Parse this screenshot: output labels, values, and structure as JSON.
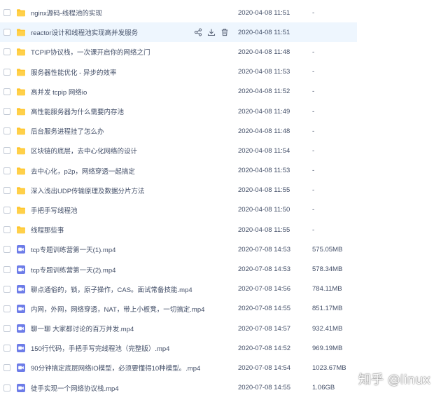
{
  "files": [
    {
      "name": "nginx源码-线程池的实现",
      "date": "2020-04-08 11:51",
      "size": "-",
      "type": "folder"
    },
    {
      "name": "reactor设计和线程池实现高并发服务",
      "date": "2020-04-08 11:51",
      "size": "",
      "type": "folder"
    },
    {
      "name": "TCPIP协议栈，一次课开启你的网络之门",
      "date": "2020-04-08 11:48",
      "size": "-",
      "type": "folder"
    },
    {
      "name": "服务器性能优化 - 异步的效率",
      "date": "2020-04-08 11:53",
      "size": "-",
      "type": "folder"
    },
    {
      "name": "高并发 tcpip 网络io",
      "date": "2020-04-08 11:52",
      "size": "-",
      "type": "folder"
    },
    {
      "name": "高性能服务器为什么需要内存池",
      "date": "2020-04-08 11:49",
      "size": "-",
      "type": "folder"
    },
    {
      "name": "后台服务进程挂了怎么办",
      "date": "2020-04-08 11:48",
      "size": "-",
      "type": "folder"
    },
    {
      "name": "区块链的底层，去中心化网络的设计",
      "date": "2020-04-08 11:54",
      "size": "-",
      "type": "folder"
    },
    {
      "name": "去中心化，p2p，网络穿透一起搞定",
      "date": "2020-04-08 11:53",
      "size": "-",
      "type": "folder"
    },
    {
      "name": "深入浅出UDP传输原理及数据分片方法",
      "date": "2020-04-08 11:55",
      "size": "-",
      "type": "folder"
    },
    {
      "name": "手把手写线程池",
      "date": "2020-04-08 11:50",
      "size": "-",
      "type": "folder"
    },
    {
      "name": "线程那些事",
      "date": "2020-04-08 11:55",
      "size": "-",
      "type": "folder"
    },
    {
      "name": "tcp专题训练营第一天(1).mp4",
      "date": "2020-07-08 14:53",
      "size": "575.05MB",
      "type": "video"
    },
    {
      "name": "tcp专题训练营第一天(2).mp4",
      "date": "2020-07-08 14:53",
      "size": "578.34MB",
      "type": "video"
    },
    {
      "name": "聊点通俗的，锁，原子操作，CAS。面试常备技能.mp4",
      "date": "2020-07-08 14:56",
      "size": "784.11MB",
      "type": "video"
    },
    {
      "name": "内网，外网，网络穿透，NAT，带上小板凳，一切搞定.mp4",
      "date": "2020-07-08 14:55",
      "size": "851.17MB",
      "type": "video"
    },
    {
      "name": "聊一聊 大家都讨论的百万并发.mp4",
      "date": "2020-07-08 14:57",
      "size": "932.41MB",
      "type": "video"
    },
    {
      "name": "150行代码，手把手写完线程池（完整版）.mp4",
      "date": "2020-07-08 14:52",
      "size": "969.19MB",
      "type": "video"
    },
    {
      "name": "90分钟搞定底层网络IO模型，必须要懂得10种模型。.mp4",
      "date": "2020-07-08 14:54",
      "size": "1023.67MB",
      "type": "video"
    },
    {
      "name": "徒手实现一个网络协议栈.mp4",
      "date": "2020-07-08 14:55",
      "size": "1.06GB",
      "type": "video"
    }
  ],
  "watermark": "知乎 @linux",
  "colors": {
    "folder": "#ffc62e",
    "video": "#6d7ce8",
    "hover_row": "#eef6fe",
    "text": "#424e67"
  }
}
